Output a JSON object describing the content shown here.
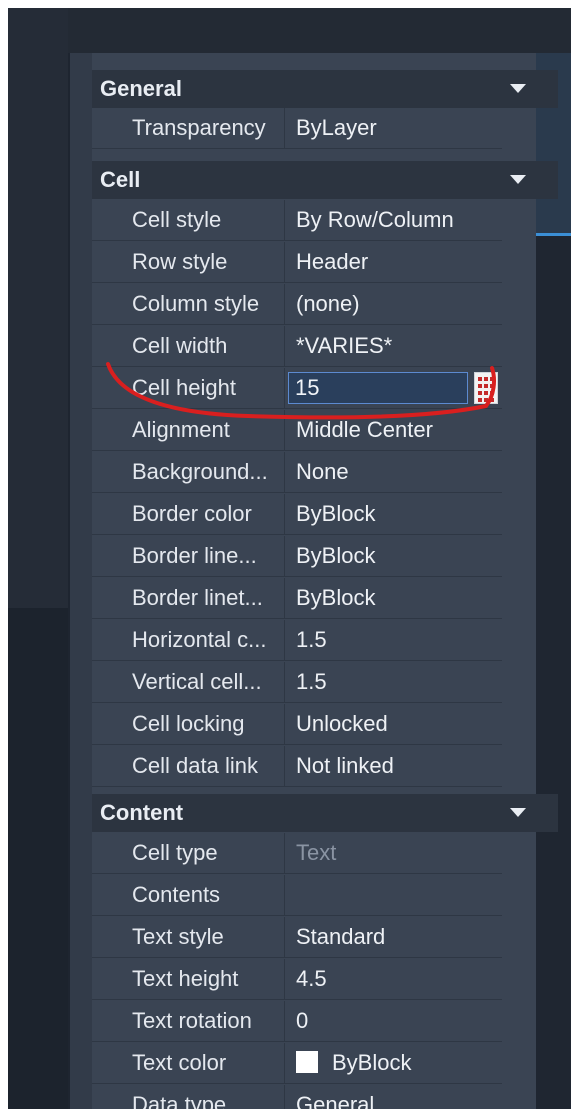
{
  "sections": {
    "general": {
      "title": "General",
      "rows": [
        {
          "name": "Transparency",
          "value": "ByLayer"
        }
      ]
    },
    "cell": {
      "title": "Cell",
      "rows": [
        {
          "name": "Cell style",
          "value": "By Row/Column"
        },
        {
          "name": "Row style",
          "value": "Header"
        },
        {
          "name": "Column style",
          "value": "(none)"
        },
        {
          "name": "Cell width",
          "value": "*VARIES*"
        },
        {
          "name": "Cell height",
          "value": "15"
        },
        {
          "name": "Alignment",
          "value": "Middle Center"
        },
        {
          "name": "Background...",
          "value": "None"
        },
        {
          "name": "Border color",
          "value": "ByBlock"
        },
        {
          "name": "Border line...",
          "value": "ByBlock"
        },
        {
          "name": "Border linet...",
          "value": "ByBlock"
        },
        {
          "name": "Horizontal c...",
          "value": "1.5"
        },
        {
          "name": "Vertical cell...",
          "value": "1.5"
        },
        {
          "name": "Cell locking",
          "value": "Unlocked"
        },
        {
          "name": "Cell data link",
          "value": "Not linked"
        }
      ]
    },
    "content": {
      "title": "Content",
      "rows": [
        {
          "name": "Cell type",
          "value": "Text"
        },
        {
          "name": "Contents",
          "value": ""
        },
        {
          "name": "Text style",
          "value": "Standard"
        },
        {
          "name": "Text height",
          "value": "4.5"
        },
        {
          "name": "Text rotation",
          "value": "0"
        },
        {
          "name": "Text color",
          "value": "ByBlock"
        },
        {
          "name": "Data type",
          "value": "General"
        }
      ]
    }
  },
  "colors": {
    "annotation": "#d91f1f",
    "swatch": "#ffffff"
  },
  "icons": {
    "collapse": "chevron-down-icon",
    "calculator": "calculator-icon"
  }
}
